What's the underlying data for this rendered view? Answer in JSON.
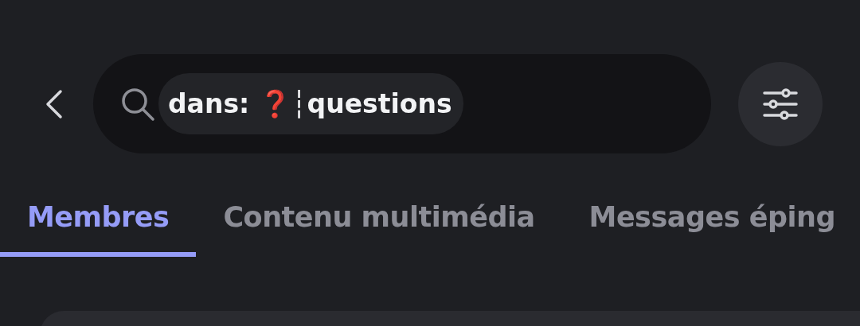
{
  "search": {
    "filter": "dans: ❓┆questions"
  },
  "tabs": [
    {
      "label": "Membres",
      "selected": true
    },
    {
      "label": "Contenu multimédia",
      "selected": false
    },
    {
      "label": "Messages éping",
      "selected": false
    }
  ]
}
